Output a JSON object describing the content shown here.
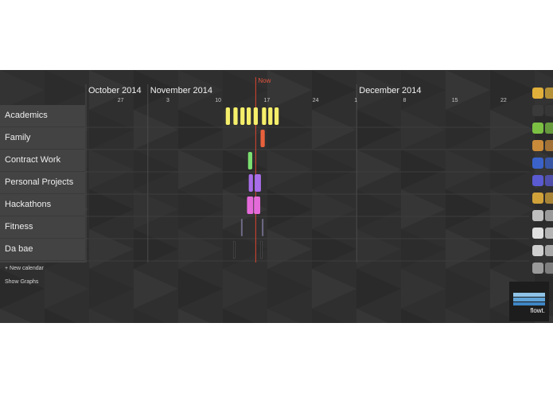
{
  "timeline": {
    "start_day": 0,
    "months": [
      {
        "label": "October 2014",
        "start": 0
      },
      {
        "label": "November 2014",
        "start": 9
      },
      {
        "label": "December 2014",
        "start": 39
      }
    ],
    "ticks": [
      {
        "label": "27",
        "day": 5
      },
      {
        "label": "3",
        "day": 12
      },
      {
        "label": "10",
        "day": 19
      },
      {
        "label": "17",
        "day": 26
      },
      {
        "label": "24",
        "day": 33
      },
      {
        "label": "1",
        "day": 39
      },
      {
        "label": "8",
        "day": 46
      },
      {
        "label": "15",
        "day": 53
      },
      {
        "label": "22",
        "day": 60
      }
    ],
    "now": {
      "label": "Now",
      "day": 24.5
    }
  },
  "calendars": [
    {
      "name": "Academics",
      "color": "#f6ef6a",
      "events": [
        {
          "day": 20.5,
          "span": 0.6
        },
        {
          "day": 21.6,
          "span": 0.6
        },
        {
          "day": 22.6,
          "span": 0.6
        },
        {
          "day": 23.5,
          "span": 0.6
        },
        {
          "day": 24.5,
          "span": 0.6
        },
        {
          "day": 25.7,
          "span": 0.6
        },
        {
          "day": 26.6,
          "span": 0.6
        },
        {
          "day": 27.5,
          "span": 0.6
        }
      ]
    },
    {
      "name": "Family",
      "color": "#e8603c",
      "events": [
        {
          "day": 25.5,
          "span": 0.6
        }
      ]
    },
    {
      "name": "Contract Work",
      "color": "#7be070",
      "events": [
        {
          "day": 23.7,
          "span": 0.6
        }
      ]
    },
    {
      "name": "Personal Projects",
      "color": "#a86de8",
      "events": [
        {
          "day": 23.8,
          "span": 0.6
        },
        {
          "day": 24.8,
          "span": 0.9
        }
      ]
    },
    {
      "name": "Hackathons",
      "color": "#e56ad9",
      "events": [
        {
          "day": 23.7,
          "span": 0.9
        },
        {
          "day": 24.7,
          "span": 0.9
        }
      ]
    },
    {
      "name": "Fitness",
      "color": "#6f6a86",
      "events": [
        {
          "day": 22.5,
          "span": 0.15
        },
        {
          "day": 25.5,
          "span": 0.15
        }
      ]
    },
    {
      "name": "Da bae",
      "color": "#222222",
      "events": [
        {
          "day": 21.4,
          "span": 0.15
        },
        {
          "day": 25.3,
          "span": 0.15
        }
      ]
    }
  ],
  "footer": {
    "new_calendar": "+ New calendar",
    "show_graphs": "Show Graphs"
  },
  "brand": {
    "name": "flowt."
  },
  "dock": {
    "icons": [
      {
        "name": "chrome-icon",
        "color": "#e0b03a"
      },
      {
        "name": "terminal-icon",
        "color": "#3a3a3a"
      },
      {
        "name": "spotify-icon",
        "color": "#7bc043"
      },
      {
        "name": "folder-icon",
        "color": "#c98a3a"
      },
      {
        "name": "office-icon",
        "color": "#3a62c9"
      },
      {
        "name": "word-icon",
        "color": "#5a5ad1"
      },
      {
        "name": "tasks-icon",
        "color": "#d1a23a"
      },
      {
        "name": "calculator-icon",
        "color": "#bfbfbf"
      },
      {
        "name": "document-icon",
        "color": "#e0e0e0"
      },
      {
        "name": "settings-icon",
        "color": "#cfcfcf"
      },
      {
        "name": "camera-icon",
        "color": "#9a9a9a"
      }
    ]
  }
}
